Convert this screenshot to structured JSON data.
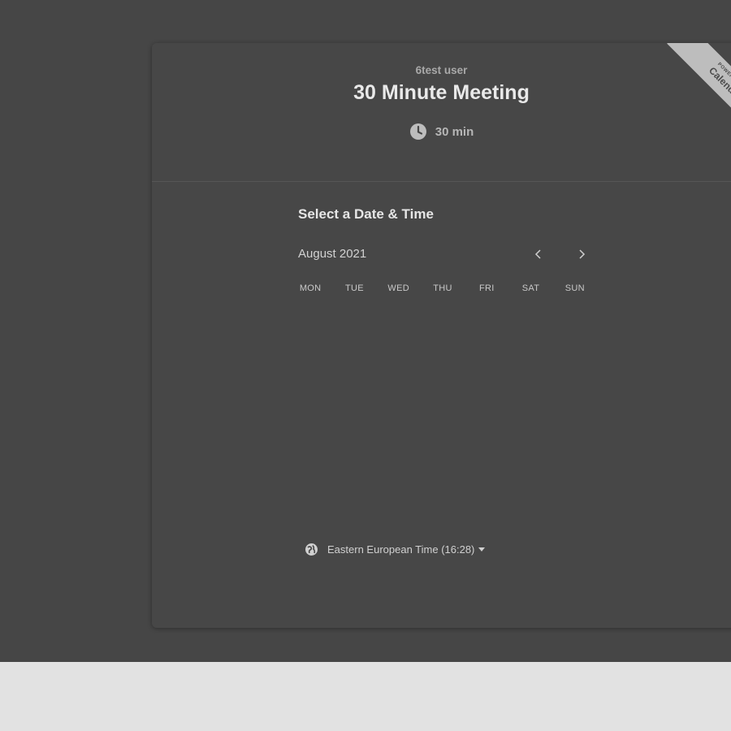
{
  "header": {
    "owner_name": "6test user",
    "event_title": "30 Minute Meeting",
    "duration_label": "30 min",
    "duration_icon": "clock-icon"
  },
  "ribbon": {
    "powered_by": "POWERED BY",
    "brand": "Calendly"
  },
  "calendar": {
    "section_title": "Select a Date & Time",
    "month_label": "August 2021",
    "prev_icon": "chevron-left-icon",
    "next_icon": "chevron-right-icon",
    "weekdays": [
      "MON",
      "TUE",
      "WED",
      "THU",
      "FRI",
      "SAT",
      "SUN"
    ]
  },
  "timezone": {
    "icon": "globe-icon",
    "label": "Eastern European Time (16:28)",
    "dropdown_icon": "caret-down-icon"
  },
  "colors": {
    "backdrop": "#464646",
    "card": "#474747",
    "footer": "#e2e2e2",
    "ribbon": "#bdbdbd"
  }
}
